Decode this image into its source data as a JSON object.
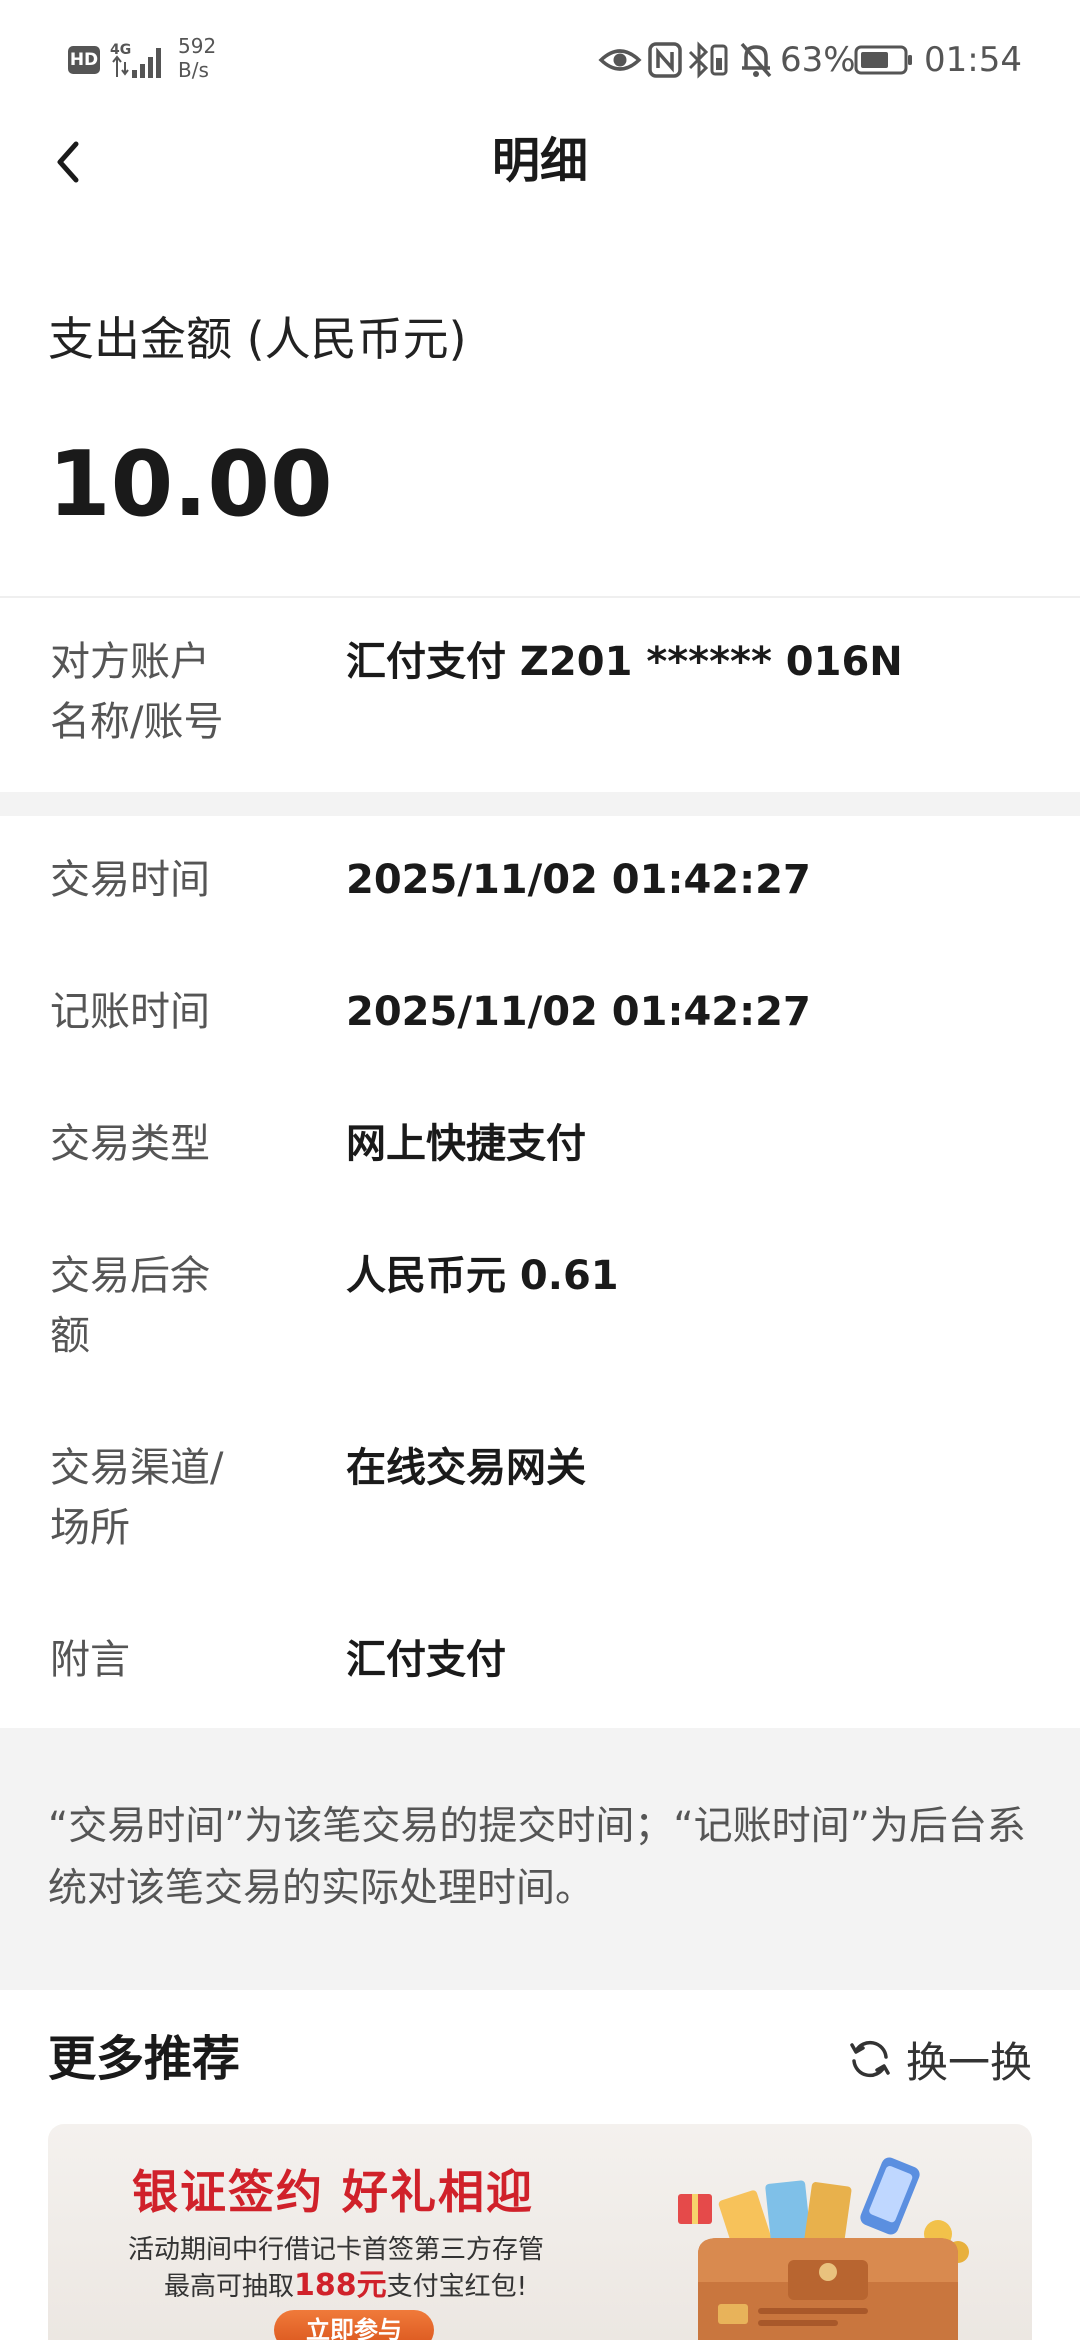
{
  "status_bar": {
    "hd": "HD",
    "network": "4G",
    "speed_value": "592",
    "speed_unit": "B/s",
    "battery": "63%",
    "time": "01:54"
  },
  "header": {
    "title": "明细"
  },
  "amount": {
    "label": "支出金额 (人民币元)",
    "value": "10.00"
  },
  "counterparty": {
    "label_line1": "对方账户",
    "label_line2": "名称/账号",
    "value": "汇付支付 Z201 ****** 016N"
  },
  "details": [
    {
      "label_line1": "交易时间",
      "label_line2": "",
      "value": "2025/11/02 01:42:27"
    },
    {
      "label_line1": "记账时间",
      "label_line2": "",
      "value": "2025/11/02 01:42:27"
    },
    {
      "label_line1": "交易类型",
      "label_line2": "",
      "value": "网上快捷支付"
    },
    {
      "label_line1": "交易后余",
      "label_line2": "额",
      "value": "人民币元 0.61"
    },
    {
      "label_line1": "交易渠道/",
      "label_line2": "场所",
      "value": "在线交易网关"
    },
    {
      "label_line1": "附言",
      "label_line2": "",
      "value": "汇付支付"
    }
  ],
  "note": "“交易时间”为该笔交易的提交时间；“记账时间”为后台系统对该笔交易的实际处理时间。",
  "recommendations": {
    "title": "更多推荐",
    "refresh_label": "换一换",
    "banner": {
      "headline": "银证签约 好礼相迎",
      "line1": "活动期间中行借记卡首签第三方存管",
      "line2_prefix": "最高可抽取",
      "line2_highlight": "188元",
      "line2_suffix": "支付宝红包!",
      "cta": "立即参与"
    }
  },
  "colors": {
    "accent_red": "#d0212a",
    "cta_orange": "#e8662a",
    "band_gray": "#f3f3f3"
  }
}
